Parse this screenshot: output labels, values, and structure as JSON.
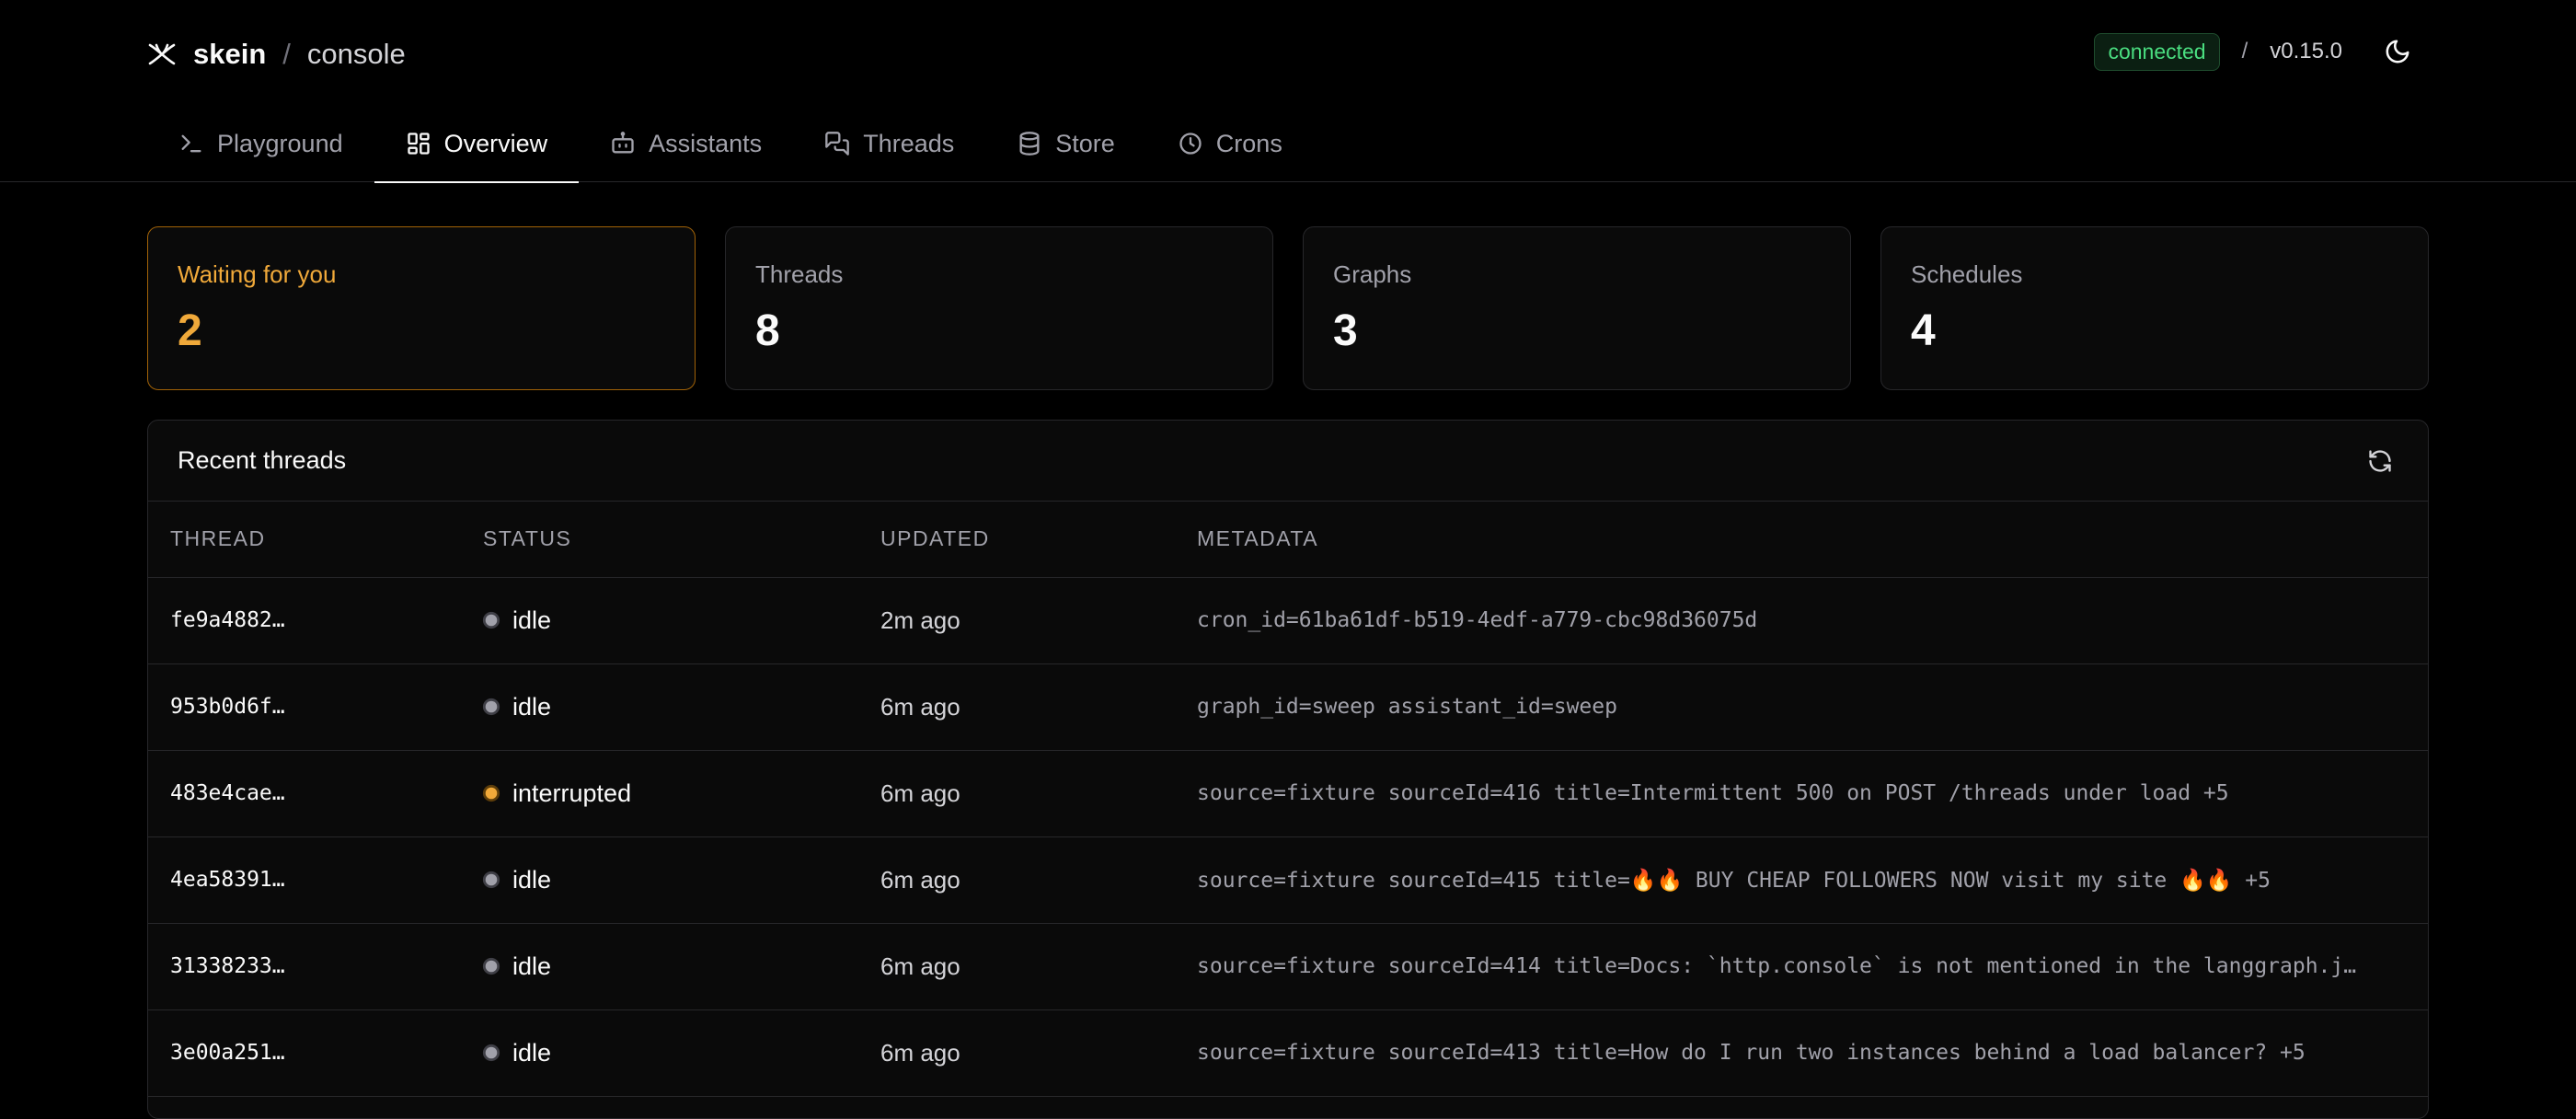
{
  "app": {
    "name": "skein",
    "separator": "/",
    "section": "console"
  },
  "connection": {
    "status": "connected",
    "separator": "/",
    "version": "v0.15.0"
  },
  "tabs": [
    {
      "label": "Playground",
      "icon": "terminal-icon"
    },
    {
      "label": "Overview",
      "icon": "dashboard-icon",
      "active": true
    },
    {
      "label": "Assistants",
      "icon": "bot-icon"
    },
    {
      "label": "Threads",
      "icon": "messages-icon"
    },
    {
      "label": "Store",
      "icon": "database-icon"
    },
    {
      "label": "Crons",
      "icon": "clock-icon"
    }
  ],
  "stats": [
    {
      "label": "Waiting for you",
      "value": "2"
    },
    {
      "label": "Threads",
      "value": "8"
    },
    {
      "label": "Graphs",
      "value": "3"
    },
    {
      "label": "Schedules",
      "value": "4"
    }
  ],
  "recent": {
    "title": "Recent threads",
    "columns": [
      "THREAD",
      "STATUS",
      "UPDATED",
      "METADATA"
    ],
    "rows": [
      {
        "thread": "fe9a4882…",
        "status": "idle",
        "updated": "2m ago",
        "metadata": "cron_id=61ba61df-b519-4edf-a779-cbc98d36075d"
      },
      {
        "thread": "953b0d6f…",
        "status": "idle",
        "updated": "6m ago",
        "metadata": "graph_id=sweep assistant_id=sweep"
      },
      {
        "thread": "483e4cae…",
        "status": "interrupted",
        "updated": "6m ago",
        "metadata": "source=fixture sourceId=416 title=Intermittent 500 on POST /threads under load +5"
      },
      {
        "thread": "4ea58391…",
        "status": "idle",
        "updated": "6m ago",
        "metadata": "source=fixture sourceId=415 title=🔥🔥 BUY CHEAP FOLLOWERS NOW visit my site 🔥🔥 +5"
      },
      {
        "thread": "31338233…",
        "status": "idle",
        "updated": "6m ago",
        "metadata": "source=fixture sourceId=414 title=Docs: `http.console` is not mentioned in the langgraph.j…"
      },
      {
        "thread": "3e00a251…",
        "status": "idle",
        "updated": "6m ago",
        "metadata": "source=fixture sourceId=413 title=How do I run two instances behind a load balancer? +5"
      }
    ]
  },
  "colors": {
    "accent": "#f0a93a",
    "connected": "#4ade80",
    "background": "#000000",
    "panel": "#0a0a0a",
    "border": "#27272a"
  }
}
